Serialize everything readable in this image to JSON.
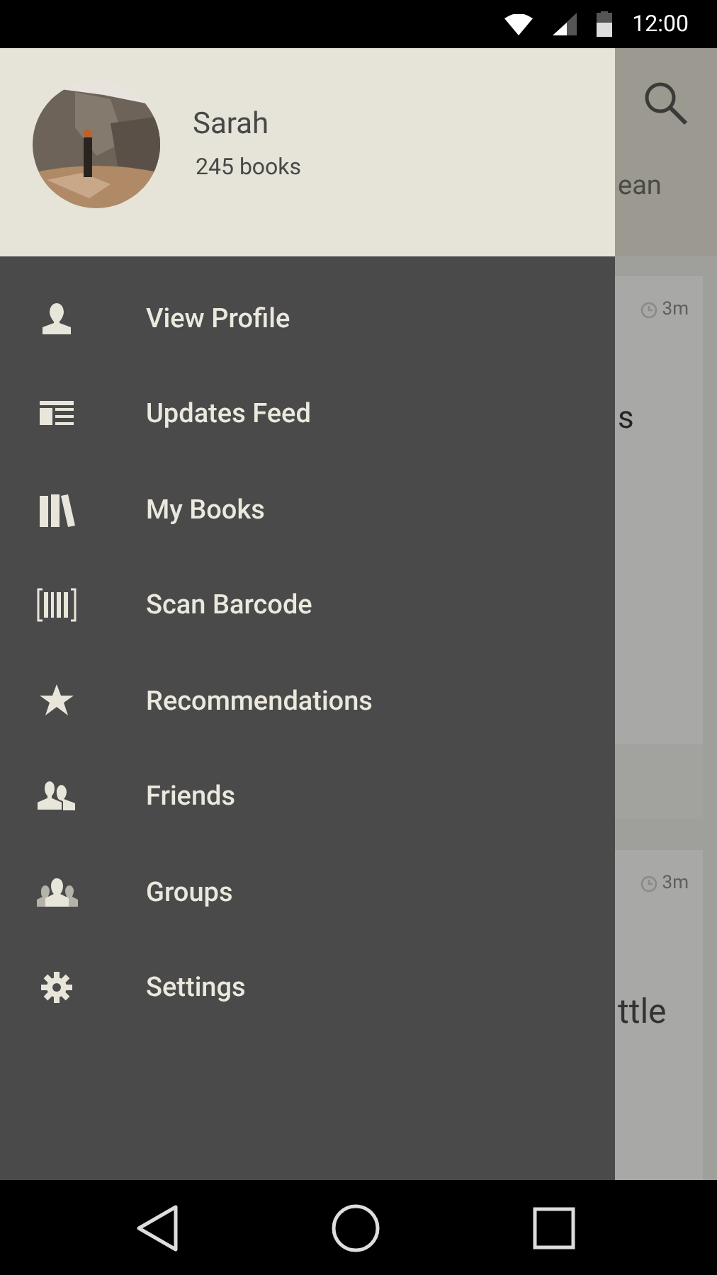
{
  "status_bar": {
    "time": "12:00"
  },
  "drawer": {
    "profile": {
      "name": "Sarah",
      "book_count": "245 books"
    },
    "menu": [
      {
        "label": "View Profile",
        "kind": "person"
      },
      {
        "label": "Updates Feed",
        "kind": "feed"
      },
      {
        "label": "My Books",
        "kind": "books"
      },
      {
        "label": "Scan Barcode",
        "kind": "barcode"
      },
      {
        "label": "Recommendations",
        "kind": "star"
      },
      {
        "label": "Friends",
        "kind": "friends"
      },
      {
        "label": "Groups",
        "kind": "groups"
      },
      {
        "label": "Settings",
        "kind": "gear"
      }
    ]
  },
  "background": {
    "header_text": "ean",
    "cards": [
      {
        "time": "3m",
        "text": "s"
      },
      {
        "time": "3m",
        "text": "ttle"
      }
    ]
  }
}
